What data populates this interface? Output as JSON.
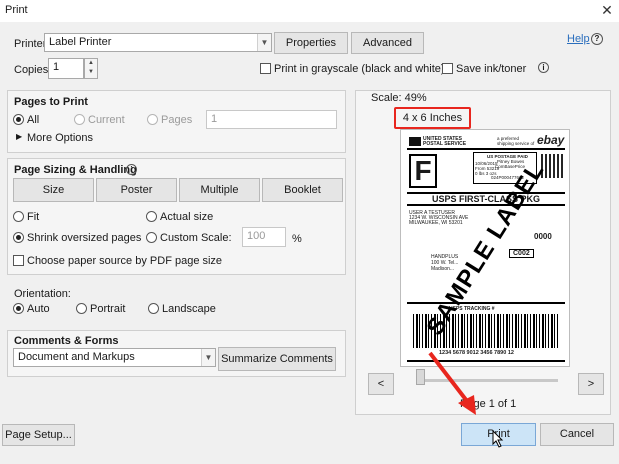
{
  "window": {
    "title": "Print",
    "close": "✕"
  },
  "printer": {
    "label": "Printer:",
    "value": "Label Printer",
    "properties_btn": "Properties",
    "advanced_btn": "Advanced",
    "help_link": "Help",
    "copies_label": "Copies:",
    "copies_value": "1",
    "grayscale_label": "Print in grayscale (black and white)",
    "save_ink_label": "Save ink/toner"
  },
  "pages_to_print": {
    "title": "Pages to Print",
    "all": "All",
    "current": "Current",
    "pages": "Pages",
    "pages_value": "1",
    "more_options": "More Options"
  },
  "sizing": {
    "title": "Page Sizing & Handling",
    "tabs": [
      "Size",
      "Poster",
      "Multiple",
      "Booklet"
    ],
    "fit": "Fit",
    "actual_size": "Actual size",
    "shrink": "Shrink oversized pages",
    "custom_scale": "Custom Scale:",
    "custom_scale_value": "100",
    "percent": "%",
    "paper_source": "Choose paper source by PDF page size"
  },
  "orientation": {
    "title": "Orientation:",
    "auto": "Auto",
    "portrait": "Portrait",
    "landscape": "Landscape"
  },
  "comments": {
    "title": "Comments & Forms",
    "value": "Document and Markups",
    "summarize_btn": "Summarize Comments"
  },
  "preview": {
    "scale": "Scale:  49%",
    "paper_size": "4 x 6 Inches",
    "prev": "<",
    "next": ">",
    "page_of": "Page 1 of 1",
    "label": {
      "usps_line1": "UNITED STATES",
      "usps_line2": "POSTAL SERVICE",
      "preferred": "a preferred",
      "preferred2": "shipping service of",
      "ebay": "ebay",
      "postage_paid": "US POSTAGE PAID",
      "pitney": "Pitney Bowes",
      "combaseprice": "ComBasePrice",
      "date": "10/06/2015",
      "from_zip": "From 53219",
      "weight": "0 lbs 3 ozs",
      "tracking_code": "024P000477662",
      "class_letter": "F",
      "service": "USPS FIRST-CLASS PKG",
      "sender1": "USER A TESTUSER",
      "sender2": "1234 W. WISCONSIN AVE",
      "sender3": "MILWAUKEE, WI 53201",
      "code1": "0000",
      "code2": "C002",
      "handplus1": "HANDPLUS",
      "handplus2": "100 W. Tel...",
      "handplus3": "Madison...",
      "tracking_title": "USPS TRACKING #",
      "tracking_number": "1234 5678 9012 3456 7890 12",
      "watermark": "SAMPLE LABEL"
    }
  },
  "footer": {
    "page_setup_btn": "Page Setup...",
    "print_btn": "Print",
    "cancel_btn": "Cancel"
  },
  "colors": {
    "highlight": "#e8261e",
    "arrow": "#e8261e",
    "primary": "#cce4f7"
  }
}
